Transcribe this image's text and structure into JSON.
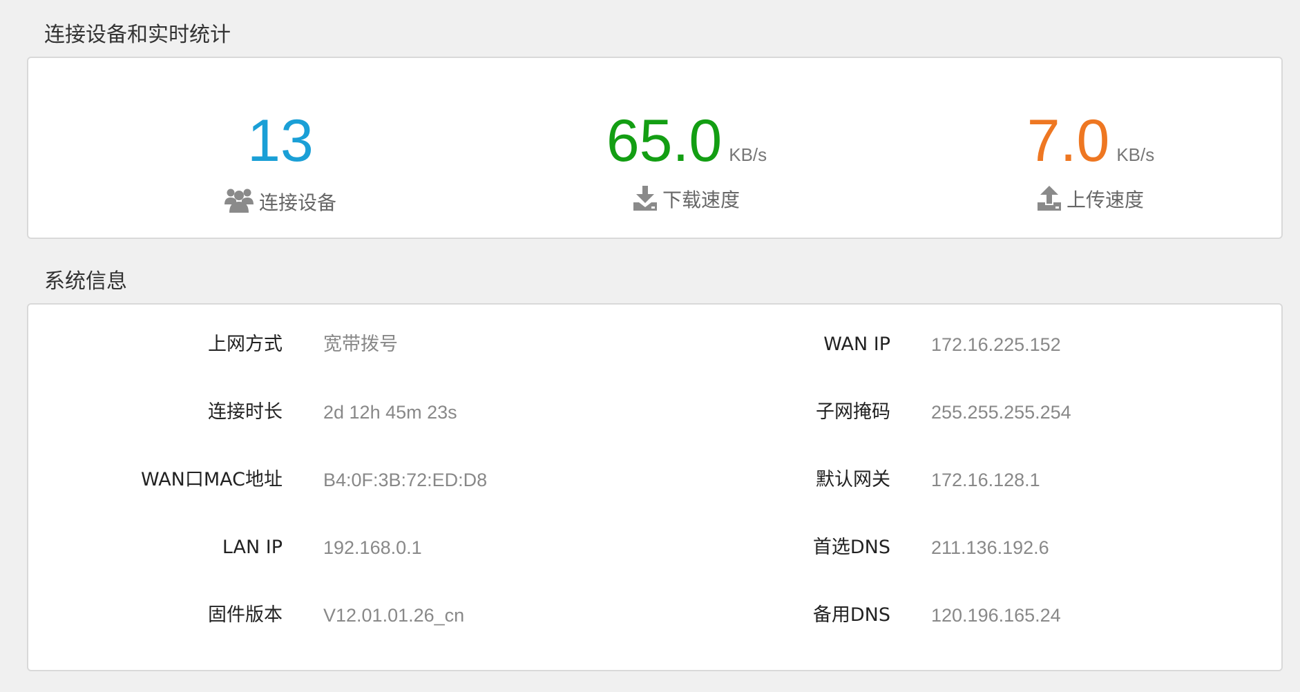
{
  "stats_section": {
    "title": "连接设备和实时统计",
    "devices": {
      "value": "13",
      "label": "连接设备",
      "icon": "users-icon",
      "color": "#1a9fd6"
    },
    "download": {
      "value": "65.0",
      "unit": "KB/s",
      "label": "下载速度",
      "icon": "download-icon",
      "color": "#139e13"
    },
    "upload": {
      "value": "7.0",
      "unit": "KB/s",
      "label": "上传速度",
      "icon": "upload-icon",
      "color": "#ee7722"
    }
  },
  "system_section": {
    "title": "系统信息",
    "left": [
      {
        "label": "上网方式",
        "value": "宽带拨号"
      },
      {
        "label": "连接时长",
        "value": "2d 12h 45m 23s"
      },
      {
        "label": "WAN口MAC地址",
        "value": "B4:0F:3B:72:ED:D8"
      },
      {
        "label": "LAN IP",
        "value": "192.168.0.1"
      },
      {
        "label": "固件版本",
        "value": "V12.01.01.26_cn"
      }
    ],
    "right": [
      {
        "label": "WAN IP",
        "value": "172.16.225.152"
      },
      {
        "label": "子网掩码",
        "value": "255.255.255.254"
      },
      {
        "label": "默认网关",
        "value": "172.16.128.1"
      },
      {
        "label": "首选DNS",
        "value": "211.136.192.6"
      },
      {
        "label": "备用DNS",
        "value": "120.196.165.24"
      }
    ]
  },
  "colors": {
    "text_label": "#222222",
    "text_value": "#888888",
    "icon_gray": "#8a8a8a",
    "panel_border": "#d9d9d9",
    "page_bg": "#f0f0f0"
  }
}
